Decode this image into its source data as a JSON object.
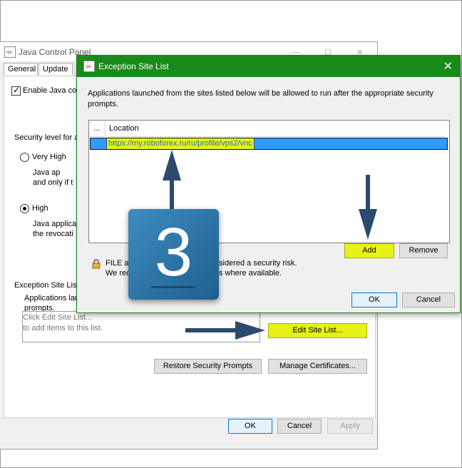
{
  "jcp": {
    "title": "Java Control Panel",
    "tabs": [
      "General",
      "Update"
    ],
    "enable_java_label": "Enable Java co",
    "security_level_label": "Security level for a",
    "very_high_label": "Very High",
    "very_high_desc_1": "Java ap",
    "very_high_desc_2": "and only if t",
    "high_label": "High",
    "high_desc_1": "Java applica",
    "high_desc_2": "the revocati",
    "exception_label": "Exception Site List",
    "exception_desc_1": "Applications lau",
    "exception_desc_2": "prompts.",
    "site_box_line1": "Click Edit Site List...",
    "site_box_line2": "to add items to this list.",
    "edit_site_list_button": "Edit Site List...",
    "restore_button": "Restore Security Prompts",
    "manage_certs_button": "Manage Certificates...",
    "ok_button": "OK",
    "cancel_button": "Cancel",
    "apply_button": "Apply"
  },
  "dialog": {
    "title": "Exception Site List",
    "description": "Applications launched from the sites listed below will be allowed to run after the appropriate security prompts.",
    "columns": [
      "...",
      "Location"
    ],
    "rows": [
      {
        "location": "https://my.roboforex.ru/ru/profile/vps2/vnc"
      }
    ],
    "add_button": "Add",
    "remove_button": "Remove",
    "warning_line1_a": "FILE a",
    "warning_line1_b": "sidered a security risk.",
    "warning_line2_a": "We rec",
    "warning_line2_b": "s where available.",
    "ok_button": "OK",
    "cancel_button": "Cancel"
  },
  "overlay": {
    "step_number": "3"
  },
  "colors": {
    "dialog_title_bar": "#1a8a1a",
    "highlight": "#e6f21a",
    "selection": "#3399ff",
    "badge": "#2a70a3",
    "arrow": "#2b4a6e"
  },
  "icons": [
    "java-icon",
    "lock-icon",
    "close-icon"
  ]
}
